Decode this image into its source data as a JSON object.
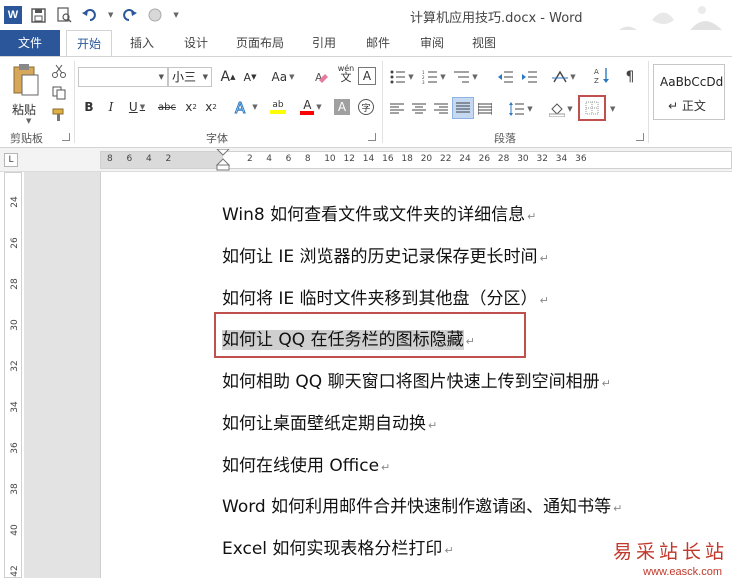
{
  "window": {
    "title": "计算机应用技巧.docx - Word",
    "app_logo": "W"
  },
  "tabs": [
    {
      "label": "文件",
      "key": "file"
    },
    {
      "label": "开始",
      "key": "home",
      "active": true
    },
    {
      "label": "插入",
      "key": "insert"
    },
    {
      "label": "设计",
      "key": "design"
    },
    {
      "label": "页面布局",
      "key": "layout"
    },
    {
      "label": "引用",
      "key": "references"
    },
    {
      "label": "邮件",
      "key": "mailings"
    },
    {
      "label": "审阅",
      "key": "review"
    },
    {
      "label": "视图",
      "key": "view"
    }
  ],
  "ribbon": {
    "clipboard": {
      "label": "剪贴板",
      "paste_label": "粘贴"
    },
    "font": {
      "label": "字体",
      "font_name": "",
      "font_size": "小三",
      "grow": "A",
      "shrink": "A",
      "case": "Aa",
      "bold": "B",
      "italic": "I",
      "underline": "U",
      "strike": "abc",
      "subscript": "x",
      "superscript": "x",
      "highlight_letter": "ab",
      "font_color_letter": "A",
      "shade_letter": "A",
      "phonetic": "wén",
      "enclose": "字"
    },
    "paragraph": {
      "label": "段落"
    },
    "styles": {
      "sample": "AaBbCcDd",
      "name": "↵ 正文"
    }
  },
  "ruler": {
    "corner": "L",
    "numbers": [
      "8",
      "6",
      "4",
      "2",
      "2",
      "4",
      "6",
      "8",
      "10",
      "12",
      "14",
      "16",
      "18",
      "20",
      "22",
      "24",
      "26",
      "28",
      "30",
      "32",
      "34",
      "36"
    ],
    "vertical_numbers": [
      "24",
      "26",
      "28",
      "30",
      "32",
      "34",
      "36",
      "38",
      "40",
      "42"
    ]
  },
  "document": {
    "paragraph_mark": "↵",
    "lines": [
      "Win8 如何查看文件或文件夹的详细信息",
      "如何让 IE 浏览器的历史记录保存更长时间",
      "如何将 IE 临时文件夹移到其他盘（分区）",
      "如何让 QQ 在任务栏的图标隐藏",
      "如何相助 QQ 聊天窗口将图片快速上传到空间相册",
      "如何让桌面壁纸定期自动换",
      "如何在线使用 Office",
      "Word 如何利用邮件合并快速制作邀请函、通知书等",
      "Excel 如何实现表格分栏打印"
    ],
    "selected_index": 3
  },
  "watermark": {
    "text": "易采站长站",
    "url": "www.easck.com"
  },
  "colors": {
    "brand": "#2b579a",
    "highlight_border": "#c0504d",
    "selection": "#cfcfcf"
  }
}
